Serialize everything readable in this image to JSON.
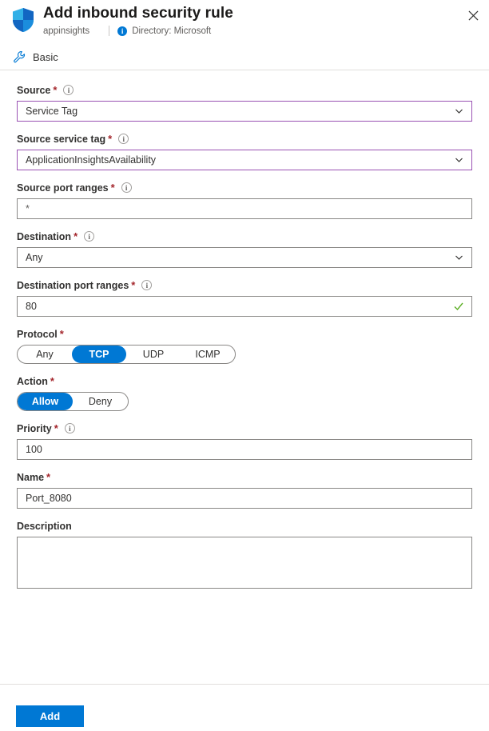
{
  "header": {
    "icon": "shield-icon",
    "title": "Add inbound security rule",
    "resource": "appinsights",
    "directory": "Directory: Microsoft",
    "info_glyph": "i",
    "close_glyph": "✕"
  },
  "tabs": [
    {
      "label": "Basic",
      "icon": "wrench-icon",
      "selected": true
    }
  ],
  "fields": {
    "source": {
      "label": "Source",
      "required": true,
      "has_info": true,
      "value": "Service Tag",
      "accent": true,
      "type": "dropdown"
    },
    "source_service_tag": {
      "label": "Source service tag",
      "required": true,
      "has_info": true,
      "value": "ApplicationInsightsAvailability",
      "accent": true,
      "type": "dropdown"
    },
    "source_port_ranges": {
      "label": "Source port ranges",
      "required": true,
      "has_info": true,
      "value": "*",
      "type": "text"
    },
    "destination": {
      "label": "Destination",
      "required": true,
      "has_info": true,
      "value": "Any",
      "type": "dropdown"
    },
    "destination_port_ranges": {
      "label": "Destination port ranges",
      "required": true,
      "has_info": true,
      "value": "80",
      "type": "text",
      "validation": "valid"
    },
    "protocol": {
      "label": "Protocol",
      "required": true,
      "has_info": false,
      "options": [
        "Any",
        "TCP",
        "UDP",
        "ICMP"
      ],
      "selected": "TCP"
    },
    "action": {
      "label": "Action",
      "required": true,
      "has_info": false,
      "options": [
        "Allow",
        "Deny"
      ],
      "selected": "Allow"
    },
    "priority": {
      "label": "Priority",
      "required": true,
      "has_info": true,
      "value": "100",
      "type": "text"
    },
    "name": {
      "label": "Name",
      "required": true,
      "has_info": false,
      "value": "Port_8080",
      "type": "text"
    },
    "description": {
      "label": "Description",
      "required": false,
      "has_info": false,
      "value": "",
      "type": "textarea"
    }
  },
  "footer": {
    "add_label": "Add"
  },
  "colors": {
    "accent_blue": "#0078d4",
    "accent_purple": "#9a52b3",
    "valid_green": "#5bae23",
    "required_red": "#a4262c",
    "border_gray": "#8a8886"
  }
}
